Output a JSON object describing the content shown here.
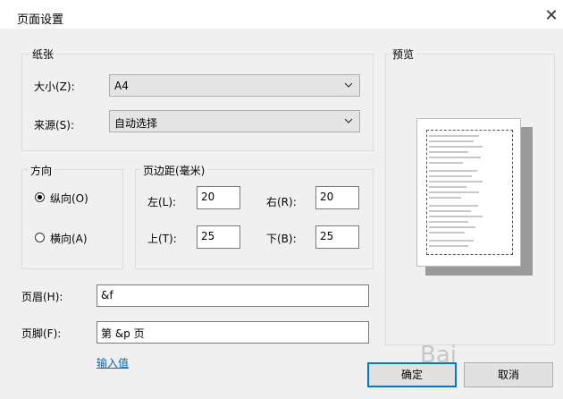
{
  "dialog": {
    "title": "页面设置"
  },
  "paper": {
    "group_label": "纸张",
    "size_label": "大小(Z):",
    "size_value": "A4",
    "source_label": "来源(S):",
    "source_value": "自动选择"
  },
  "orientation": {
    "group_label": "方向",
    "portrait_label": "纵向(O)",
    "landscape_label": "横向(A)",
    "selected": "portrait"
  },
  "margins": {
    "group_label": "页边距(毫米)",
    "left_label": "左(L):",
    "left_value": "20",
    "right_label": "右(R):",
    "right_value": "20",
    "top_label": "上(T):",
    "top_value": "25",
    "bottom_label": "下(B):",
    "bottom_value": "25"
  },
  "header": {
    "label": "页眉(H):",
    "value": "&f"
  },
  "footer": {
    "label": "页脚(F):",
    "value": "第 &p 页"
  },
  "input_values_link": "输入值",
  "preview": {
    "group_label": "预览"
  },
  "buttons": {
    "ok": "确定",
    "cancel": "取消"
  },
  "watermark": "Bai"
}
